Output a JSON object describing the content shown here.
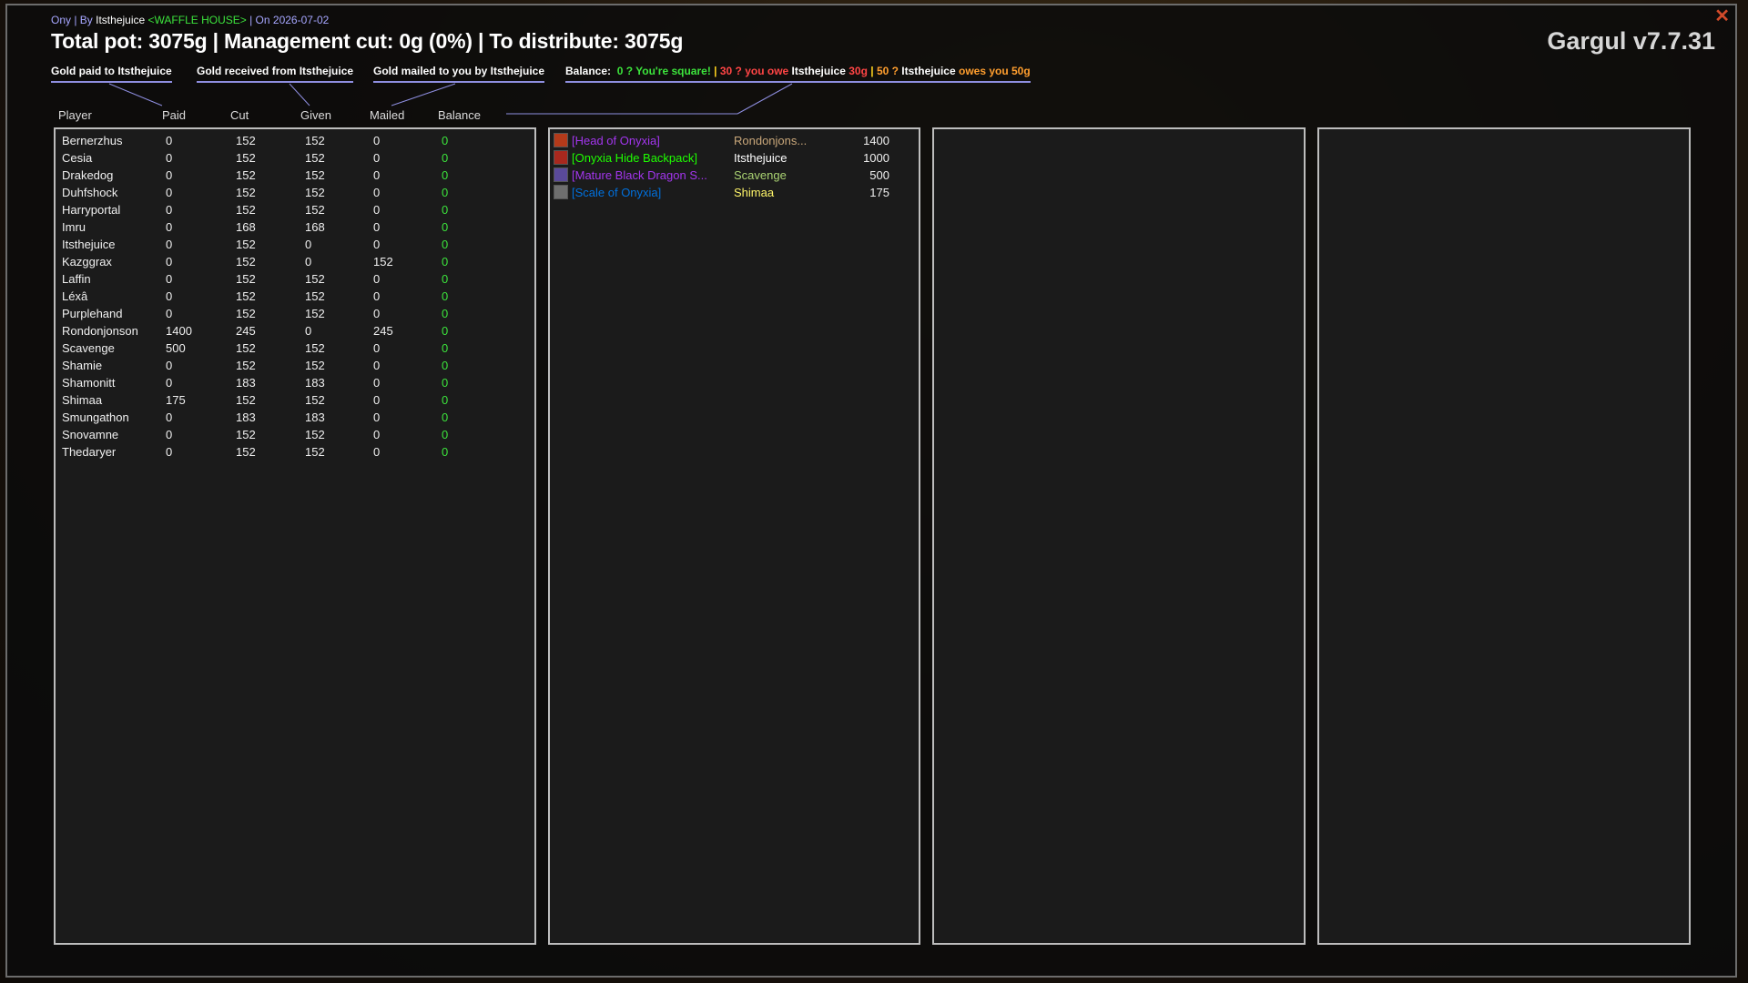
{
  "header": {
    "raid": "Ony",
    "by_sep": " | By ",
    "author": "Itsthejuice",
    "guild": "<WAFFLE HOUSE>",
    "date_sep": " | On ",
    "date": "2026-07-02",
    "title": "Total pot: 3075g | Management cut: 0g (0%) | To distribute: 3075g",
    "version": "Gargul v7.7.31"
  },
  "legend": {
    "paid": "Gold paid to Itsthejuice",
    "received": "Gold received from Itsthejuice",
    "mailed": "Gold mailed to you by Itsthejuice",
    "balance_label": "Balance:",
    "square": "0 ? You're square!",
    "sep": " | ",
    "owe_prefix": "30 ? you owe ",
    "owe_name": "Itsthejuice",
    "owe_amount": " 30g",
    "owes_prefix": "50 ? ",
    "owes_name": "Itsthejuice",
    "owes_suffix": " owes you 50g"
  },
  "columns": {
    "player": "Player",
    "paid": "Paid",
    "cut": "Cut",
    "given": "Given",
    "mailed": "Mailed",
    "balance": "Balance"
  },
  "players": [
    {
      "name": "Bernerzhus",
      "paid": "0",
      "cut": "152",
      "given": "152",
      "mailed": "0",
      "balance": "0"
    },
    {
      "name": "Cesia",
      "paid": "0",
      "cut": "152",
      "given": "152",
      "mailed": "0",
      "balance": "0"
    },
    {
      "name": "Drakedog",
      "paid": "0",
      "cut": "152",
      "given": "152",
      "mailed": "0",
      "balance": "0"
    },
    {
      "name": "Duhfshock",
      "paid": "0",
      "cut": "152",
      "given": "152",
      "mailed": "0",
      "balance": "0"
    },
    {
      "name": "Harryportal",
      "paid": "0",
      "cut": "152",
      "given": "152",
      "mailed": "0",
      "balance": "0"
    },
    {
      "name": "Imru",
      "paid": "0",
      "cut": "168",
      "given": "168",
      "mailed": "0",
      "balance": "0"
    },
    {
      "name": "Itsthejuice",
      "paid": "0",
      "cut": "152",
      "given": "0",
      "mailed": "0",
      "balance": "0"
    },
    {
      "name": "Kazggrax",
      "paid": "0",
      "cut": "152",
      "given": "0",
      "mailed": "152",
      "balance": "0"
    },
    {
      "name": "Laffin",
      "paid": "0",
      "cut": "152",
      "given": "152",
      "mailed": "0",
      "balance": "0"
    },
    {
      "name": "Léxâ",
      "paid": "0",
      "cut": "152",
      "given": "152",
      "mailed": "0",
      "balance": "0"
    },
    {
      "name": "Purplehand",
      "paid": "0",
      "cut": "152",
      "given": "152",
      "mailed": "0",
      "balance": "0"
    },
    {
      "name": "Rondonjonson",
      "paid": "1400",
      "cut": "245",
      "given": "0",
      "mailed": "245",
      "balance": "0"
    },
    {
      "name": "Scavenge",
      "paid": "500",
      "cut": "152",
      "given": "152",
      "mailed": "0",
      "balance": "0"
    },
    {
      "name": "Shamie",
      "paid": "0",
      "cut": "152",
      "given": "152",
      "mailed": "0",
      "balance": "0"
    },
    {
      "name": "Shamonitt",
      "paid": "0",
      "cut": "183",
      "given": "183",
      "mailed": "0",
      "balance": "0"
    },
    {
      "name": "Shimaa",
      "paid": "175",
      "cut": "152",
      "given": "152",
      "mailed": "0",
      "balance": "0"
    },
    {
      "name": "Smungathon",
      "paid": "0",
      "cut": "183",
      "given": "183",
      "mailed": "0",
      "balance": "0"
    },
    {
      "name": "Snovamne",
      "paid": "0",
      "cut": "152",
      "given": "152",
      "mailed": "0",
      "balance": "0"
    },
    {
      "name": "Thedaryer",
      "paid": "0",
      "cut": "152",
      "given": "152",
      "mailed": "0",
      "balance": "0"
    }
  ],
  "items": [
    {
      "name": "[Head of Onyxia]",
      "winner": "Rondonjons...",
      "price": "1400",
      "color": "#a335ee",
      "winner_color": "#c9a77a",
      "icon": "head-of-onyxia-icon",
      "icon_color": "#b33a1a"
    },
    {
      "name": "[Onyxia Hide Backpack]",
      "winner": "Itsthejuice",
      "price": "1000",
      "color": "#1eff00",
      "winner_color": "#ffffff",
      "icon": "backpack-icon",
      "icon_color": "#a8281e"
    },
    {
      "name": "[Mature Black Dragon S...",
      "winner": "Scavenge",
      "price": "500",
      "color": "#a335ee",
      "winner_color": "#abd473",
      "icon": "dragon-sinew-icon",
      "icon_color": "#5a4a9a"
    },
    {
      "name": "[Scale of Onyxia]",
      "winner": "Shimaa",
      "price": "175",
      "color": "#0070dd",
      "winner_color": "#fff569",
      "icon": "scale-icon",
      "icon_color": "#6e6e6e"
    }
  ],
  "colors": {
    "balance_zero": "#3ce33c",
    "legend_underline": "#8e8ee0",
    "panel_border": "#bdbdbd"
  }
}
